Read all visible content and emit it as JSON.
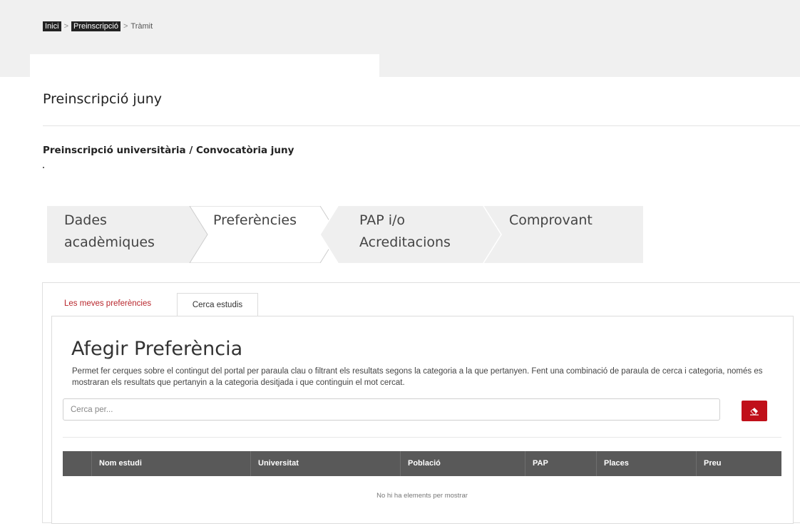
{
  "breadcrumb": {
    "home": "Inici",
    "separator": ">",
    "section": "Preinscripció",
    "current": "Tràmit"
  },
  "page_title": "Preinscripció juny",
  "subtitle": "Preinscripció universitària / Convocatòria juny",
  "steps": [
    {
      "line1": "Dades",
      "line2": "acadèmiques",
      "active": false
    },
    {
      "line1": "Preferències",
      "line2": "",
      "active": true
    },
    {
      "line1": "PAP i/o",
      "line2": "Acreditacions",
      "active": false
    },
    {
      "line1": "Comprovant",
      "line2": "",
      "active": false
    }
  ],
  "tabs": {
    "my_preferences": "Les meves preferències",
    "search_studies": "Cerca estudis"
  },
  "add_preference": {
    "title": "Afegir Preferència",
    "description": "Permet fer cerques sobre el contingut del portal per paraula clau o filtrant els resultats segons la categoria a la que pertanyen. Fent una combinació de paraula de cerca i categoria, només es mostraran els resultats que pertanyin a la categoria desitjada i que continguin el mot cercat.",
    "search_placeholder": "Cerca per...",
    "search_value": "",
    "clear_icon": "eraser-icon"
  },
  "table": {
    "columns": [
      "",
      "Nom estudi",
      "Universitat",
      "Població",
      "PAP",
      "Places",
      "Preu"
    ],
    "empty_message": "No hi ha elements per mostrar"
  },
  "colors": {
    "accent_red": "#c0101a",
    "tab_red_text": "#b8262c",
    "table_header": "#595959",
    "step_background": "#efefef",
    "breadcrumb_link_bg": "#222222"
  }
}
